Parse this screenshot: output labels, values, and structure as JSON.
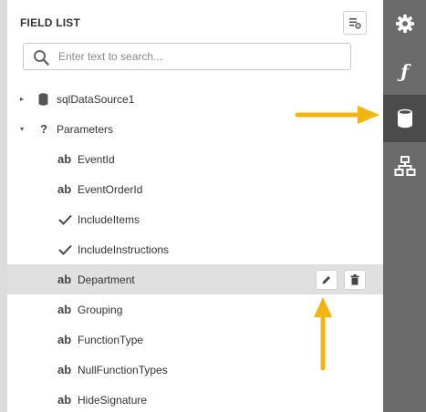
{
  "field_list": {
    "title": "FIELD LIST",
    "search": {
      "placeholder": "Enter text to search...",
      "value": ""
    },
    "items": [
      {
        "label": "sqlDataSource1",
        "icon": "database-icon",
        "expander": "▸"
      },
      {
        "label": "Parameters",
        "icon": "question-icon",
        "icon_text": "?",
        "expander": "▾"
      },
      {
        "label": "EventId",
        "icon": "string-type-icon",
        "icon_text": "ab"
      },
      {
        "label": "EventOrderId",
        "icon": "string-type-icon",
        "icon_text": "ab"
      },
      {
        "label": "IncludeItems",
        "icon": "boolean-check-icon"
      },
      {
        "label": "IncludeInstructions",
        "icon": "boolean-check-icon"
      },
      {
        "label": "Department",
        "icon": "string-type-icon",
        "icon_text": "ab",
        "selected": true
      },
      {
        "label": "Grouping",
        "icon": "string-type-icon",
        "icon_text": "ab"
      },
      {
        "label": "FunctionType",
        "icon": "string-type-icon",
        "icon_text": "ab"
      },
      {
        "label": "NullFunctionTypes",
        "icon": "string-type-icon",
        "icon_text": "ab"
      },
      {
        "label": "HideSignature",
        "icon": "string-type-icon",
        "icon_text": "ab"
      }
    ],
    "row_actions": [
      "edit-pencil-icon",
      "delete-trash-icon"
    ]
  },
  "sidebar_tools": [
    {
      "name": "properties",
      "icon": "gear-icon"
    },
    {
      "name": "expressions",
      "icon": "function-icon",
      "glyph": "ƒ"
    },
    {
      "name": "field-list",
      "icon": "database-icon",
      "active": true
    },
    {
      "name": "report-explorer",
      "icon": "hierarchy-icon"
    }
  ],
  "colors": {
    "sidebar": "#6b6b6b",
    "sidebar_active": "#4b4b4b",
    "selected_row": "#e0e0e0",
    "annotation_arrow": "#f2b50f"
  }
}
